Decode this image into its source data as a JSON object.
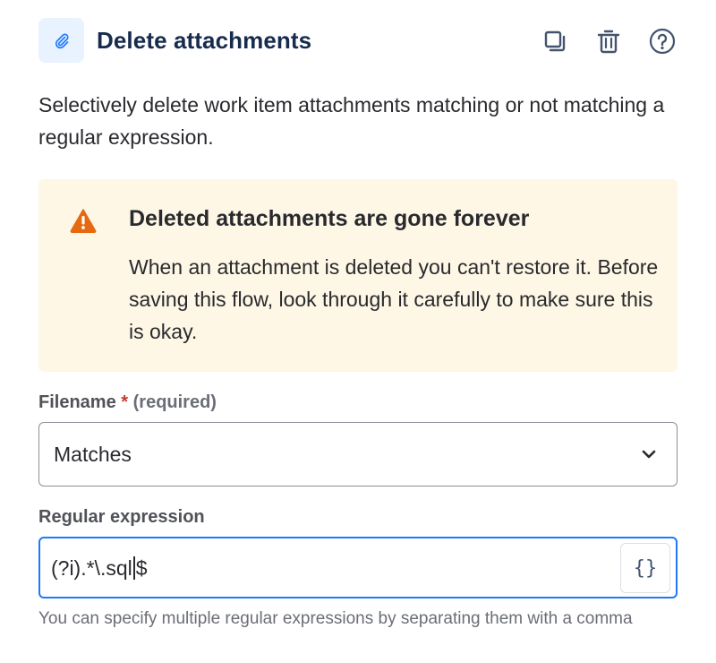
{
  "header": {
    "icon": "paperclip-icon",
    "title": "Delete attachments",
    "actions": [
      {
        "icon": "duplicate-icon"
      },
      {
        "icon": "trash-icon"
      },
      {
        "icon": "help-icon"
      }
    ]
  },
  "description": "Selectively delete work item attachments matching or not matching a regular expression.",
  "warning": {
    "icon": "warning-icon",
    "title": "Deleted attachments are gone forever",
    "body": "When an attachment is deleted you can't restore it. Before saving this flow, look through it carefully to make sure this is okay.",
    "color": "#fff7e6",
    "icon_color": "#e56910"
  },
  "filename": {
    "label": "Filename",
    "required_marker": "*",
    "required_text": "(required)",
    "value": "Matches",
    "icon": "chevron-down-icon"
  },
  "regex": {
    "label": "Regular expression",
    "value_before_caret": "(?i).*\\.sql",
    "value_after_caret": "$",
    "smart_value_button": "{}",
    "helper": "You can specify multiple regular expressions by separating them with a comma"
  },
  "colors": {
    "accent": "#1d7afc",
    "required": "#c9372c"
  }
}
